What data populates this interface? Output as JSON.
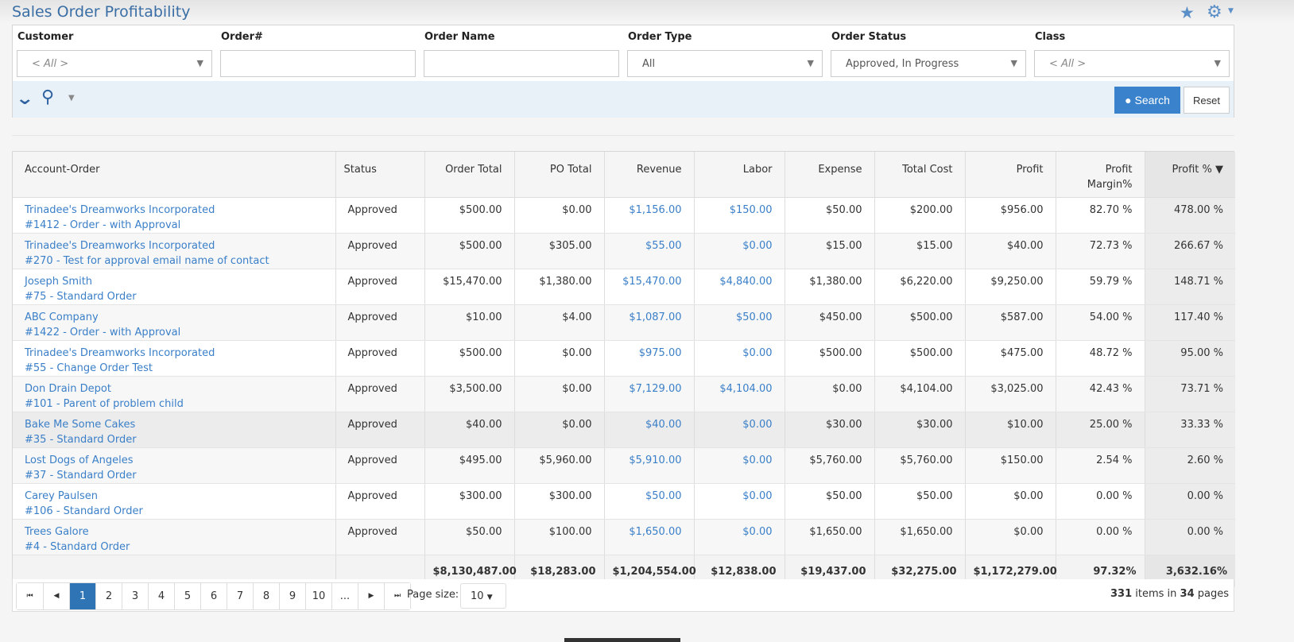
{
  "header": {
    "title": "Sales Order Profitability",
    "favorite_icon": "star-icon",
    "settings_icon": "gear-icon"
  },
  "filters": [
    {
      "label": "Customer",
      "value": "< All >",
      "type": "select",
      "placeholder": true
    },
    {
      "label": "Order#",
      "value": "",
      "type": "text"
    },
    {
      "label": "Order Name",
      "value": "",
      "type": "text"
    },
    {
      "label": "Order Type",
      "value": "All",
      "type": "select"
    },
    {
      "label": "Order Status",
      "value": "Approved, In Progress",
      "type": "select"
    },
    {
      "label": "Class",
      "value": "< All >",
      "type": "select",
      "placeholder": true
    }
  ],
  "toolbar": {
    "search_label": "Search",
    "reset_label": "Reset"
  },
  "columns": [
    "Account-Order",
    "Status",
    "Order Total",
    "PO Total",
    "Revenue",
    "Labor",
    "Expense",
    "Total Cost",
    "Profit",
    "Profit Margin%",
    "Profit % ▼"
  ],
  "rows": [
    {
      "account": "Trinadee's Dreamworks Incorporated",
      "order": "#1412 - Order - with Approval",
      "status": "Approved",
      "order_total": "$500.00",
      "po_total": "$0.00",
      "revenue": "$1,156.00",
      "labor": "$150.00",
      "expense": "$50.00",
      "total_cost": "$200.00",
      "profit": "$956.00",
      "margin": "82.70 %",
      "profit_pct": "478.00 %"
    },
    {
      "account": "Trinadee's Dreamworks Incorporated",
      "order": "#270 - Test for approval email name of contact",
      "status": "Approved",
      "order_total": "$500.00",
      "po_total": "$305.00",
      "revenue": "$55.00",
      "labor": "$0.00",
      "expense": "$15.00",
      "total_cost": "$15.00",
      "profit": "$40.00",
      "margin": "72.73 %",
      "profit_pct": "266.67 %"
    },
    {
      "account": "Joseph Smith",
      "order": "#75 - Standard Order",
      "status": "Approved",
      "order_total": "$15,470.00",
      "po_total": "$1,380.00",
      "revenue": "$15,470.00",
      "labor": "$4,840.00",
      "expense": "$1,380.00",
      "total_cost": "$6,220.00",
      "profit": "$9,250.00",
      "margin": "59.79 %",
      "profit_pct": "148.71 %"
    },
    {
      "account": "ABC Company",
      "order": "#1422 - Order - with Approval",
      "status": "Approved",
      "order_total": "$10.00",
      "po_total": "$4.00",
      "revenue": "$1,087.00",
      "labor": "$50.00",
      "expense": "$450.00",
      "total_cost": "$500.00",
      "profit": "$587.00",
      "margin": "54.00 %",
      "profit_pct": "117.40 %"
    },
    {
      "account": "Trinadee's Dreamworks Incorporated",
      "order": "#55 - Change Order Test",
      "status": "Approved",
      "order_total": "$500.00",
      "po_total": "$0.00",
      "revenue": "$975.00",
      "labor": "$0.00",
      "expense": "$500.00",
      "total_cost": "$500.00",
      "profit": "$475.00",
      "margin": "48.72 %",
      "profit_pct": "95.00 %"
    },
    {
      "account": "Don Drain Depot",
      "order": "#101 - Parent of problem child",
      "status": "Approved",
      "order_total": "$3,500.00",
      "po_total": "$0.00",
      "revenue": "$7,129.00",
      "labor": "$4,104.00",
      "expense": "$0.00",
      "total_cost": "$4,104.00",
      "profit": "$3,025.00",
      "margin": "42.43 %",
      "profit_pct": "73.71 %"
    },
    {
      "account": "Bake Me Some Cakes",
      "order": "#35 - Standard Order",
      "status": "Approved",
      "order_total": "$40.00",
      "po_total": "$0.00",
      "revenue": "$40.00",
      "labor": "$0.00",
      "expense": "$30.00",
      "total_cost": "$30.00",
      "profit": "$10.00",
      "margin": "25.00 %",
      "profit_pct": "33.33 %"
    },
    {
      "account": "Lost Dogs of Angeles",
      "order": "#37 - Standard Order",
      "status": "Approved",
      "order_total": "$495.00",
      "po_total": "$5,960.00",
      "revenue": "$5,910.00",
      "labor": "$0.00",
      "expense": "$5,760.00",
      "total_cost": "$5,760.00",
      "profit": "$150.00",
      "margin": "2.54 %",
      "profit_pct": "2.60 %"
    },
    {
      "account": "Carey Paulsen",
      "order": "#106 - Standard Order",
      "status": "Approved",
      "order_total": "$300.00",
      "po_total": "$300.00",
      "revenue": "$50.00",
      "labor": "$0.00",
      "expense": "$50.00",
      "total_cost": "$50.00",
      "profit": "$0.00",
      "margin": "0.00 %",
      "profit_pct": "0.00 %"
    },
    {
      "account": "Trees Galore",
      "order": "#4 - Standard Order",
      "status": "Approved",
      "order_total": "$50.00",
      "po_total": "$100.00",
      "revenue": "$1,650.00",
      "labor": "$0.00",
      "expense": "$1,650.00",
      "total_cost": "$1,650.00",
      "profit": "$0.00",
      "margin": "0.00 %",
      "profit_pct": "0.00 %"
    }
  ],
  "totals": {
    "order_total": "$8,130,487.00",
    "po_total": "$18,283.00",
    "revenue": "$1,204,554.00",
    "labor": "$12,838.00",
    "expense": "$19,437.00",
    "total_cost": "$32,275.00",
    "profit": "$1,172,279.00",
    "margin": "97.32%",
    "profit_pct": "3,632.16%"
  },
  "pager": {
    "pages": [
      "1",
      "2",
      "3",
      "4",
      "5",
      "6",
      "7",
      "8",
      "9",
      "10",
      "..."
    ],
    "current": "1",
    "page_size_label": "Page size:",
    "page_size": "10",
    "items": "331",
    "items_text": " items in ",
    "pages_total": "34",
    "pages_text": " pages"
  }
}
